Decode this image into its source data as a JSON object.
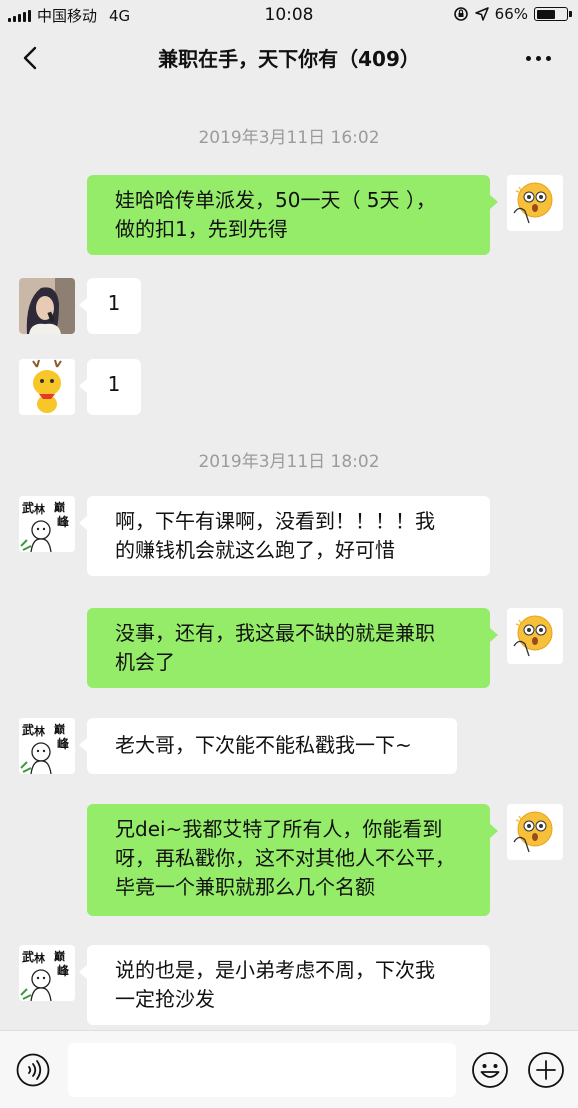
{
  "status_bar": {
    "carrier": "中国移动",
    "network": "4G",
    "time": "10:08",
    "battery": "66%",
    "battery_level": 0.66
  },
  "header": {
    "title": "兼职在手，天下你有（409）",
    "back_icon": "chevron-left-icon",
    "more_icon": "more-dots-icon"
  },
  "chat": {
    "timestamps": [
      "2019年3月11日 16:02",
      "2019年3月11日 18:02"
    ],
    "messages": [
      {
        "side": "out",
        "avatar": "emoji-face-avatar",
        "lines": [
          "娃哈哈传单派发，50一天（ 5天 ），",
          "做的扣1，先到先得"
        ]
      },
      {
        "side": "in",
        "avatar": "girl-photo-avatar",
        "lines": [
          "1"
        ]
      },
      {
        "side": "in",
        "avatar": "yellow-deer-avatar",
        "lines": [
          "1"
        ]
      },
      {
        "side": "in",
        "avatar": "sketch-character-avatar",
        "lines": [
          "啊，下午有课啊，没看到！！！！我",
          "的赚钱机会就这么跑了，好可惜"
        ]
      },
      {
        "side": "out",
        "avatar": "emoji-face-avatar",
        "lines": [
          "没事，还有，我这最不缺的就是兼职",
          "机会了"
        ]
      },
      {
        "side": "in",
        "avatar": "sketch-character-avatar",
        "lines": [
          "老大哥，下次能不能私戳我一下~"
        ]
      },
      {
        "side": "out",
        "avatar": "emoji-face-avatar",
        "lines": [
          "兄dei~我都艾特了所有人，你能看到",
          "呀，再私戳你，这不对其他人不公平，",
          "毕竟一个兼职就那么几个名额"
        ]
      },
      {
        "side": "in",
        "avatar": "sketch-character-avatar",
        "lines": [
          "说的也是，是小弟考虑不周，下次我",
          "一定抢沙发"
        ]
      }
    ]
  },
  "input_bar": {
    "voice_icon": "voice-icon",
    "input_value": "",
    "emoji_icon": "emoji-icon",
    "plus_icon": "plus-icon"
  },
  "colors": {
    "background": "#ededed",
    "outgoing_bubble": "#95ec69",
    "incoming_bubble": "#ffffff",
    "timestamp_text": "#9b9b9b"
  }
}
